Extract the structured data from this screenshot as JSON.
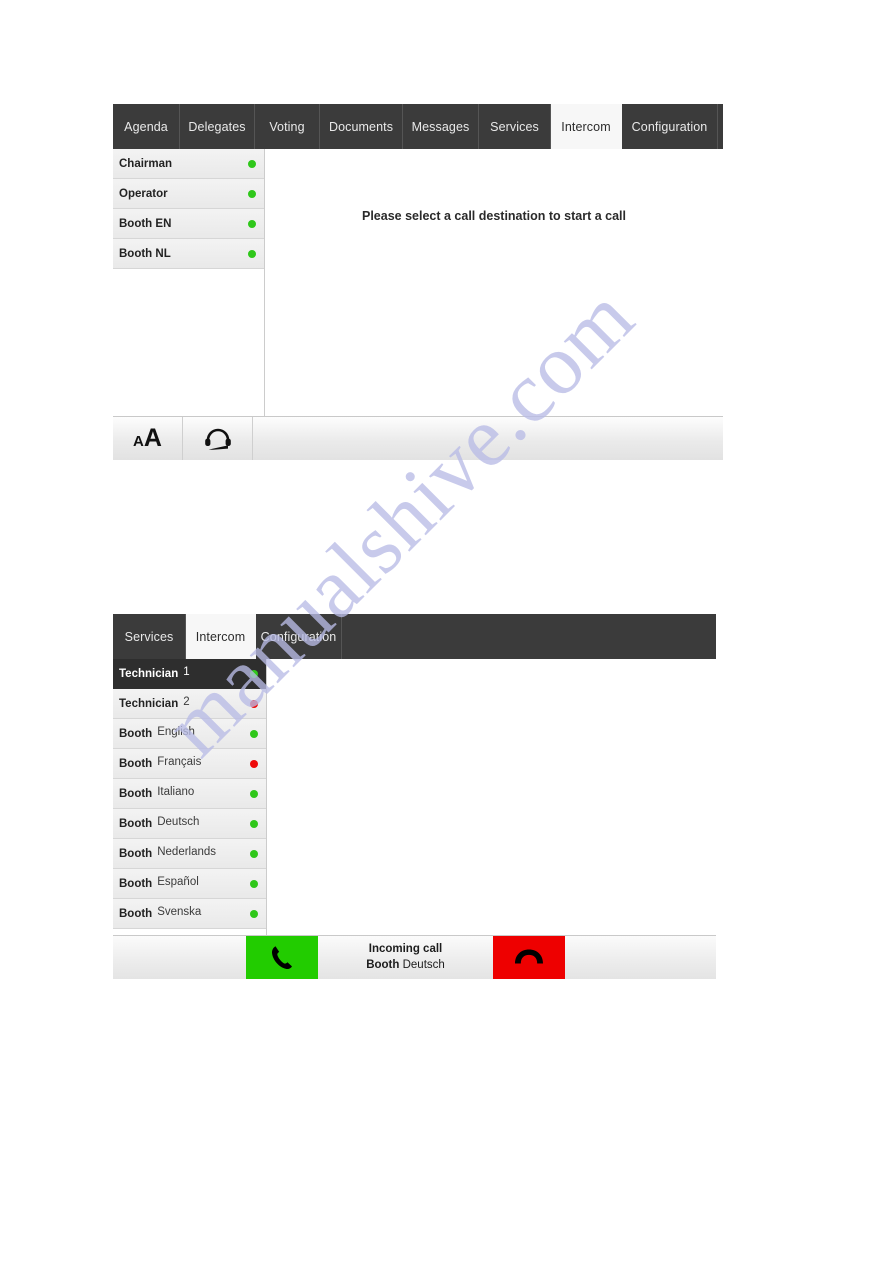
{
  "watermark": {
    "text": "manualshive.com"
  },
  "panel_one": {
    "tabs": [
      {
        "label": "Agenda",
        "active": false
      },
      {
        "label": "Delegates",
        "active": false
      },
      {
        "label": "Voting",
        "active": false
      },
      {
        "label": "Documents",
        "active": false
      },
      {
        "label": "Messages",
        "active": false
      },
      {
        "label": "Services",
        "active": false
      },
      {
        "label": "Intercom",
        "active": true
      },
      {
        "label": "Configuration",
        "active": false
      }
    ],
    "list": [
      {
        "label": "Chairman",
        "sublabel": "",
        "status": "green",
        "selected": false
      },
      {
        "label": "Operator",
        "sublabel": "",
        "status": "green",
        "selected": false
      },
      {
        "label": "Booth EN",
        "sublabel": "",
        "status": "green",
        "selected": false
      },
      {
        "label": "Booth NL",
        "sublabel": "",
        "status": "green",
        "selected": false
      }
    ],
    "message": "Please select a call destination to start a call",
    "toolbar": {
      "font_size_icon": "font-size-icon",
      "font_size_small": "A",
      "font_size_big": "A",
      "headset_icon": "headset-icon"
    }
  },
  "panel_two": {
    "tabs": [
      {
        "label": "Services",
        "active": false
      },
      {
        "label": "Intercom",
        "active": true
      },
      {
        "label": "Configuration",
        "active": false
      }
    ],
    "list": [
      {
        "label": "Technician",
        "sublabel": "1",
        "status": "green",
        "selected": true
      },
      {
        "label": "Technician",
        "sublabel": "2",
        "status": "red",
        "selected": false
      },
      {
        "label": "Booth",
        "sublabel": "English",
        "status": "green",
        "selected": false
      },
      {
        "label": "Booth",
        "sublabel": "Français",
        "status": "red",
        "selected": false
      },
      {
        "label": "Booth",
        "sublabel": "Italiano",
        "status": "green",
        "selected": false
      },
      {
        "label": "Booth",
        "sublabel": "Deutsch",
        "status": "green",
        "selected": false
      },
      {
        "label": "Booth",
        "sublabel": "Nederlands",
        "status": "green",
        "selected": false
      },
      {
        "label": "Booth",
        "sublabel": "Español",
        "status": "green",
        "selected": false
      },
      {
        "label": "Booth",
        "sublabel": "Svenska",
        "status": "green",
        "selected": false
      }
    ],
    "call_bar": {
      "status_line": "Incoming call",
      "caller_label": "Booth",
      "caller_name": "Deutsch",
      "accept_icon": "phone-accept-icon",
      "decline_icon": "phone-decline-icon"
    }
  },
  "colors": {
    "tab_bar": "#3b3b3b",
    "tab_active": "#f7f7f7",
    "status_green": "#2fc71a",
    "status_red": "#ee0b0b",
    "accept_green": "#22cc00",
    "decline_red": "#ee0000",
    "selected_row": "#2e2e2e",
    "watermark": "#b9bce6"
  }
}
